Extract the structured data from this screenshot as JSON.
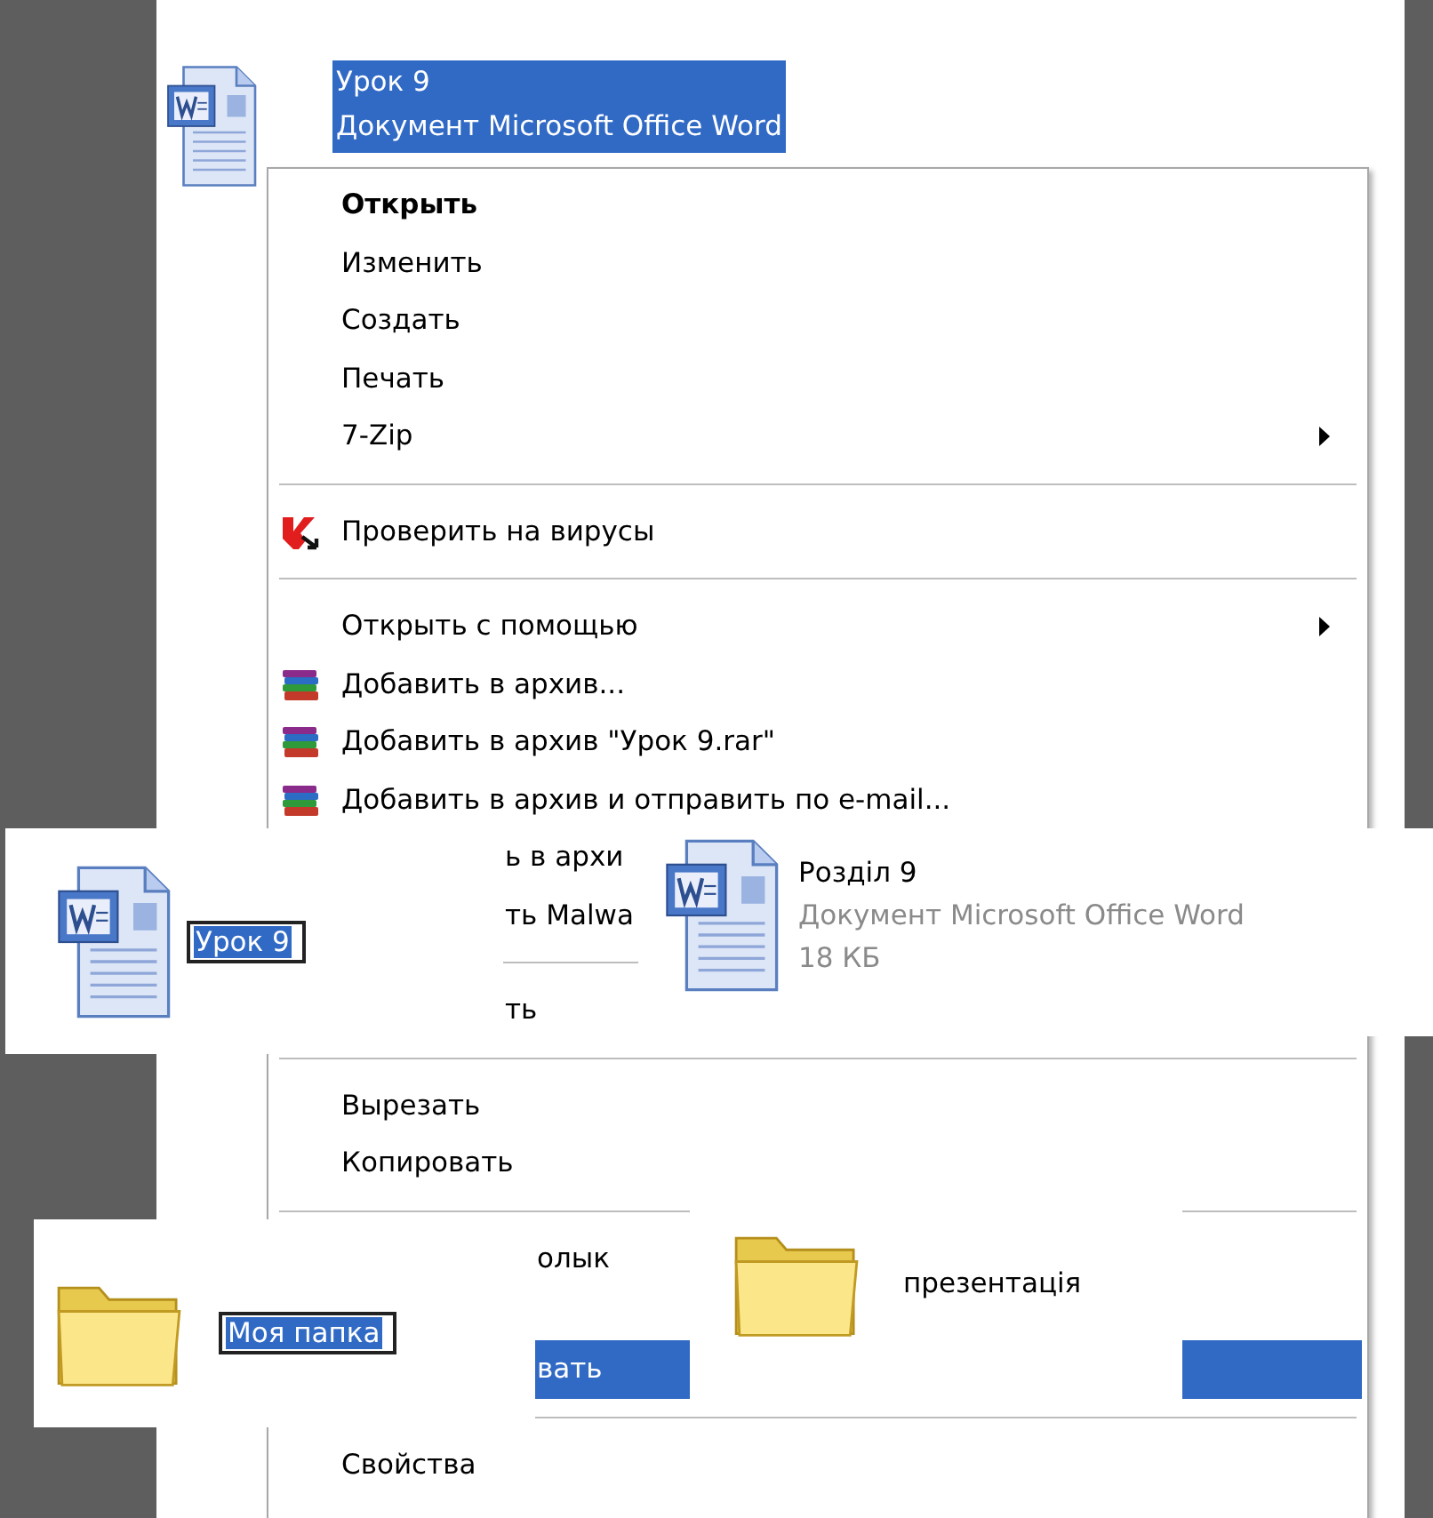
{
  "file_item": {
    "name": "Урок 9",
    "type": "Документ Microsoft Office Word",
    "selected": true
  },
  "context_menu": {
    "items": [
      {
        "kind": "command",
        "label": "Открыть",
        "default": true,
        "submenu": false,
        "selected": false
      },
      {
        "kind": "command",
        "label": "Изменить",
        "default": false,
        "submenu": false,
        "selected": false
      },
      {
        "kind": "command",
        "label": "Создать",
        "default": false,
        "submenu": false,
        "selected": false
      },
      {
        "kind": "command",
        "label": "Печать",
        "default": false,
        "submenu": false,
        "selected": false
      },
      {
        "kind": "command",
        "label": "7-Zip",
        "default": false,
        "submenu": true,
        "selected": false
      },
      {
        "kind": "separator"
      },
      {
        "kind": "scan",
        "label": "Проверить на вирусы",
        "default": false,
        "submenu": false,
        "selected": false
      },
      {
        "kind": "separator"
      },
      {
        "kind": "command",
        "label": "Открыть с помощью",
        "default": false,
        "submenu": true,
        "selected": false
      },
      {
        "kind": "archive",
        "label": "Добавить в архив...",
        "default": false,
        "submenu": false,
        "selected": false
      },
      {
        "kind": "archive",
        "label": "Добавить в архив \"Урок 9.rar\"",
        "default": false,
        "submenu": false,
        "selected": false
      },
      {
        "kind": "archive",
        "label": "Добавить в архив и отправить по e-mail...",
        "default": false,
        "submenu": false,
        "selected": false
      },
      {
        "kind": "partial",
        "label": "ь в архи",
        "selected": false
      },
      {
        "kind": "partial",
        "label": "ть Malwa",
        "selected": false
      },
      {
        "kind": "separator"
      },
      {
        "kind": "partial",
        "label": "ть",
        "selected": false
      },
      {
        "kind": "separator"
      },
      {
        "kind": "command",
        "label": "Вырезать",
        "default": false,
        "submenu": false,
        "selected": false
      },
      {
        "kind": "command",
        "label": "Копировать",
        "default": false,
        "submenu": false,
        "selected": false
      },
      {
        "kind": "separator"
      },
      {
        "kind": "partial",
        "label": "олык",
        "selected": false
      },
      {
        "kind": "covered"
      },
      {
        "kind": "partial",
        "label": "вать",
        "selected": true
      },
      {
        "kind": "separator"
      },
      {
        "kind": "command",
        "label": "Свойства",
        "default": false,
        "submenu": false,
        "selected": false
      }
    ]
  },
  "overlays": [
    {
      "kind": "doc-rename",
      "value": "Урок 9",
      "selected": true
    },
    {
      "kind": "doc-details",
      "name": "Розділ 9",
      "type": "Документ Microsoft Office Word",
      "size": "18 КБ"
    },
    {
      "kind": "folder-rename",
      "value": "Моя папка",
      "selected": true
    },
    {
      "kind": "folder",
      "name": "презентація"
    }
  ]
}
